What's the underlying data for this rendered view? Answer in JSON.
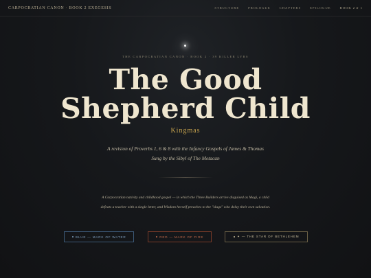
{
  "header": {
    "brand": "Carpocratian Canon · Book 2 Exegesis",
    "nav": [
      "Structure",
      "Prologue",
      "Chapters",
      "Epilogue",
      "Book 2 ▸ 1"
    ]
  },
  "hero": {
    "kicker": "The Carpocratian Canon · Book 2 · 39 Killer Lyrs",
    "title_line1": "The Good",
    "title_line2": "Shepherd Child",
    "subtitle": "Kingmas",
    "description_line1": "A revision of Proverbs 1, 6 & 8 with the Infancy Gospels of James & Thomas",
    "description_line2": "Sung by the Sibyl of The Metacan",
    "body_line1": "A Carpocratian nativity and childhood gospel — in which the Three Builders arrive disguised as Magi, a child",
    "body_line2": "defeats a teacher with a single letter, and Wisdom herself preaches to the \"slugs\" who delay their own salvation."
  },
  "buttons": [
    {
      "label": "Blue — Mark of Water",
      "color": "#7fa0c0"
    },
    {
      "label": "Red — Mark of Fire",
      "color": "#c26a4c"
    },
    {
      "label": "✦ — The Star of Bethlehem",
      "color": "#cbbf9d"
    }
  ]
}
